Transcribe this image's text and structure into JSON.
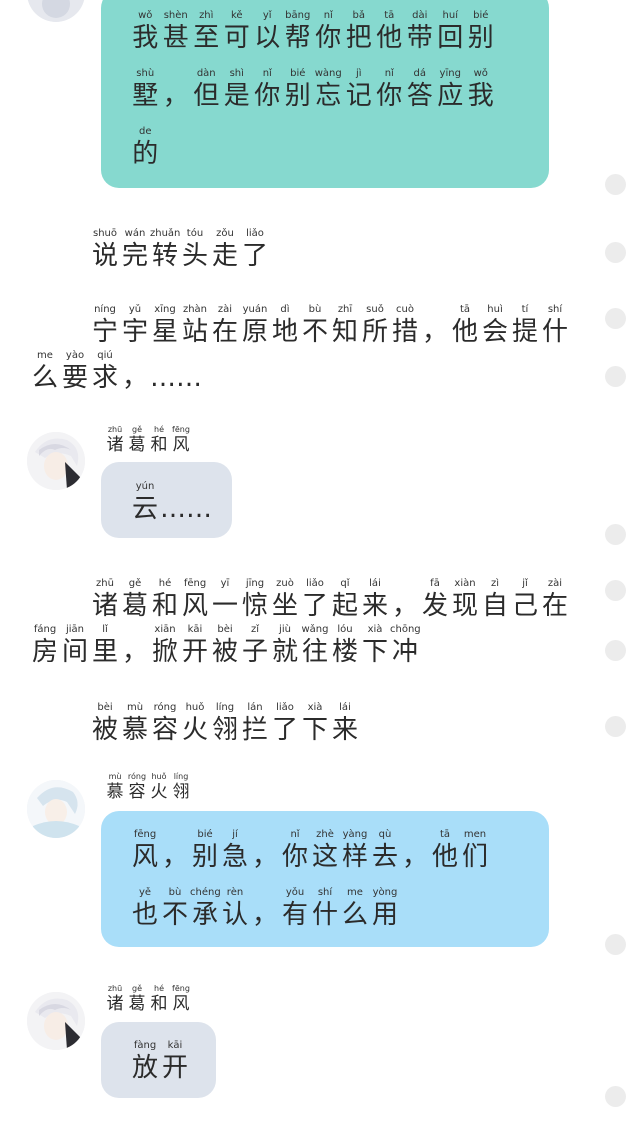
{
  "colors": {
    "teal_bubble": "#86d9cf",
    "blue_bubble": "#a9def9",
    "gray_bubble": "#dde3ec"
  },
  "messages": [
    {
      "id": "m1",
      "lines": [
        [
          [
            "wǒ",
            "我"
          ],
          [
            "shèn",
            "甚"
          ],
          [
            "zhì",
            "至"
          ],
          [
            "kě",
            "可"
          ],
          [
            "yǐ",
            "以"
          ],
          [
            "bāng",
            "帮"
          ],
          [
            "nǐ",
            "你"
          ],
          [
            "bǎ",
            "把"
          ],
          [
            "tā",
            "他"
          ],
          [
            "dài",
            "带"
          ],
          [
            "huí",
            "回"
          ],
          [
            "bié",
            "别"
          ]
        ],
        [
          [
            "shù",
            "墅"
          ],
          [
            "",
            "，"
          ],
          [
            "dàn",
            "但"
          ],
          [
            "shì",
            "是"
          ],
          [
            "nǐ",
            "你"
          ],
          [
            "bié",
            "别"
          ],
          [
            "wàng",
            "忘"
          ],
          [
            "jì",
            "记"
          ],
          [
            "nǐ",
            "你"
          ],
          [
            "dá",
            "答"
          ],
          [
            "yīng",
            "应"
          ],
          [
            "wǒ",
            "我"
          ]
        ],
        [
          [
            "de",
            "的"
          ]
        ]
      ]
    }
  ],
  "narration": {
    "n1": [
      [
        [
          "shuō",
          "说"
        ],
        [
          "wán",
          "完"
        ],
        [
          "zhuǎn",
          "转"
        ],
        [
          "tóu",
          "头"
        ],
        [
          "zǒu",
          "走"
        ],
        [
          "liǎo",
          "了"
        ]
      ]
    ],
    "n2": [
      [
        [
          "",
          ""
        ],
        [
          "níng",
          "宁"
        ],
        [
          "yǔ",
          "宇"
        ],
        [
          "xīng",
          "星"
        ],
        [
          "zhàn",
          "站"
        ],
        [
          "zài",
          "在"
        ],
        [
          "yuán",
          "原"
        ],
        [
          "dì",
          "地"
        ],
        [
          "bù",
          "不"
        ],
        [
          "zhī",
          "知"
        ],
        [
          "suǒ",
          "所"
        ],
        [
          "cuò",
          "措"
        ],
        [
          "",
          "，"
        ],
        [
          "tā",
          "他"
        ],
        [
          "huì",
          "会"
        ],
        [
          "tí",
          "提"
        ],
        [
          "shí",
          "什"
        ]
      ],
      [
        [
          "me",
          "么"
        ],
        [
          "yào",
          "要"
        ],
        [
          "qiú",
          "求"
        ],
        [
          "",
          "，"
        ],
        [
          "",
          "……"
        ]
      ]
    ],
    "n3": [
      [
        [
          "",
          ""
        ],
        [
          "zhū",
          "诸"
        ],
        [
          "gě",
          "葛"
        ],
        [
          "hé",
          "和"
        ],
        [
          "fēng",
          "风"
        ],
        [
          "yī",
          "一"
        ],
        [
          "jīng",
          "惊"
        ],
        [
          "zuò",
          "坐"
        ],
        [
          "liǎo",
          "了"
        ],
        [
          "qǐ",
          "起"
        ],
        [
          "lái",
          "来"
        ],
        [
          "",
          "，"
        ],
        [
          "fā",
          "发"
        ],
        [
          "xiàn",
          "现"
        ],
        [
          "zì",
          "自"
        ],
        [
          "jǐ",
          "己"
        ],
        [
          "zài",
          "在"
        ]
      ],
      [
        [
          "fáng",
          "房"
        ],
        [
          "jiān",
          "间"
        ],
        [
          "lǐ",
          "里"
        ],
        [
          "",
          "，"
        ],
        [
          "xiān",
          "掀"
        ],
        [
          "kāi",
          "开"
        ],
        [
          "bèi",
          "被"
        ],
        [
          "zǐ",
          "子"
        ],
        [
          "jiù",
          "就"
        ],
        [
          "wǎng",
          "往"
        ],
        [
          "lóu",
          "楼"
        ],
        [
          "xià",
          "下"
        ],
        [
          "chōng",
          "冲"
        ]
      ]
    ],
    "n4": [
      [
        [
          "bèi",
          "被"
        ],
        [
          "mù",
          "慕"
        ],
        [
          "róng",
          "容"
        ],
        [
          "huǒ",
          "火"
        ],
        [
          "líng",
          "翎"
        ],
        [
          "lán",
          "拦"
        ],
        [
          "liǎo",
          "了"
        ],
        [
          "xià",
          "下"
        ],
        [
          "lái",
          "来"
        ]
      ]
    ]
  },
  "names": {
    "zhuge": [
      [
        "zhū",
        "诸"
      ],
      [
        "gě",
        "葛"
      ],
      [
        "hé",
        "和"
      ],
      [
        "fēng",
        "风"
      ]
    ],
    "murong": [
      [
        "mù",
        "慕"
      ],
      [
        "róng",
        "容"
      ],
      [
        "huǒ",
        "火"
      ],
      [
        "líng",
        "翎"
      ]
    ]
  },
  "bubbles": {
    "yun": [
      [
        [
          "yún",
          "云"
        ],
        [
          "",
          "……"
        ]
      ]
    ],
    "murong_msg": [
      [
        [
          "fēng",
          "风"
        ],
        [
          "",
          "，"
        ],
        [
          "bié",
          "别"
        ],
        [
          "jí",
          "急"
        ],
        [
          "",
          "，"
        ],
        [
          "nǐ",
          "你"
        ],
        [
          "zhè",
          "这"
        ],
        [
          "yàng",
          "样"
        ],
        [
          "qù",
          "去"
        ],
        [
          "",
          "，"
        ],
        [
          "tā",
          "他"
        ],
        [
          "men",
          "们"
        ]
      ],
      [
        [
          "yě",
          "也"
        ],
        [
          "bù",
          "不"
        ],
        [
          "chéng",
          "承"
        ],
        [
          "rèn",
          "认"
        ],
        [
          "",
          "，"
        ],
        [
          "yǒu",
          "有"
        ],
        [
          "shí",
          "什"
        ],
        [
          "me",
          "么"
        ],
        [
          "yòng",
          "用"
        ]
      ]
    ],
    "fangkai": [
      [
        [
          "fàng",
          "放"
        ],
        [
          "kāi",
          "开"
        ]
      ]
    ]
  },
  "avatars": {
    "zhuge": "anime-character-avatar-white-hair",
    "murong": "anime-character-avatar-light-blue-hair"
  }
}
